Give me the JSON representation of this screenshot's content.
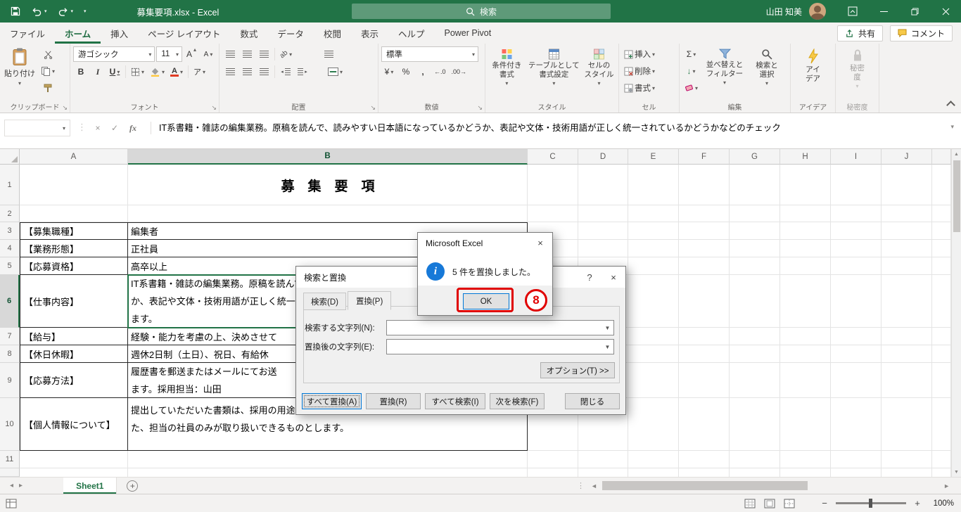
{
  "colors": {
    "excel_green": "#217346",
    "annotation_red": "#e00000",
    "info_blue": "#1779d8"
  },
  "title_bar": {
    "doc_title": "募集要項.xlsx - Excel",
    "search_label": "検索",
    "user_name": "山田 知美"
  },
  "tabs": {
    "file": "ファイル",
    "home": "ホーム",
    "insert": "挿入",
    "layout": "ページ レイアウト",
    "formulas": "数式",
    "data": "データ",
    "review": "校閲",
    "view": "表示",
    "help": "ヘルプ",
    "power_pivot": "Power Pivot",
    "share": "共有",
    "comments": "コメント"
  },
  "ribbon": {
    "paste": "貼り付け",
    "clipboard_group": "クリップボード",
    "font_name": "游ゴシック",
    "font_size": "11",
    "font_group": "フォント",
    "align_group": "配置",
    "number_format": "標準",
    "number_group": "数値",
    "conditional": "条件付き\n書式",
    "format_table": "テーブルとして\n書式設定",
    "cell_styles": "セルの\nスタイル",
    "styles_group": "スタイル",
    "insert": "挿入",
    "delete": "削除",
    "format": "書式",
    "cells_group": "セル",
    "sort_filter": "並べ替えと\nフィルター",
    "find_select": "検索と\n選択",
    "editing_group": "編集",
    "ideas": "アイ\nデア",
    "ideas_group": "アイデア",
    "sensitivity": "秘密\n度",
    "sensitivity_group": "秘密度"
  },
  "glyphs": {
    "bold": "B",
    "italic": "I",
    "underline": "U",
    "autosum": "Σ",
    "phonetic": "ア",
    "currency": "¥",
    "percent": "%",
    "comma": ",",
    "fx": "fx",
    "orientation": "ab",
    "dec_left": "←.0",
    "dec_right": ".00→",
    "fill": "↓"
  },
  "formula_bar": {
    "name_box": "",
    "value": "IT系書籍・雑誌の編集業務。原稿を読んで、読みやすい日本語になっているかどうか、表記や文体・技術用語が正しく統一されているかどうかなどのチェック"
  },
  "grid": {
    "columns": [
      "A",
      "B",
      "C",
      "D",
      "E",
      "F",
      "G",
      "H",
      "I",
      "J"
    ],
    "rows": [
      "1",
      "2",
      "3",
      "4",
      "5",
      "6",
      "7",
      "8",
      "9",
      "10",
      "11"
    ],
    "cells": {
      "b1": "募　集　要　項",
      "a3": "【募集職種】",
      "b3": "編集者",
      "a4": "【業務形態】",
      "b4": "正社員",
      "a5": "【応募資格】",
      "b5": "高卒以上",
      "a6": "【仕事内容】",
      "b6": "IT系書籍・雑誌の編集業務。原稿を読んで、読みやすい日本語になっているかどう\nか、表記や文体・技術用語が正しく統一されているかどうかなどのチェックをし\nます。",
      "a7": "【給与】",
      "b7": "経験・能力を考慮の上、決めさせて",
      "a8": "【休日休暇】",
      "b8": "週休2日制（土日）、祝日、有給休",
      "a9": "【応募方法】",
      "b9": "履歴書を郵送またはメールにてお送\nます。採用担当：山田",
      "a10": "【個人情報について】",
      "b10": "提出していただいた書類は、採用の用途でのみ使用し、厳重に管理いたします。ま\nた、担当の社員のみが取り扱いできるものとします。"
    }
  },
  "find_replace": {
    "title": "検索と置換",
    "help": "?",
    "close_x": "×",
    "tab_find": "検索(D)",
    "tab_replace": "置換(P)",
    "find_label": "検索する文字列(N):",
    "replace_label": "置換後の文字列(E):",
    "options": "オプション(T) >>",
    "replace_all": "すべて置換(A)",
    "replace": "置換(R)",
    "find_all": "すべて検索(I)",
    "find_next": "次を検索(F)",
    "close": "閉じる"
  },
  "message_box": {
    "title": "Microsoft Excel",
    "close_x": "×",
    "info_glyph": "i",
    "message": "5 件を置換しました。",
    "ok": "OK",
    "annotation_number": "8"
  },
  "sheet_bar": {
    "sheet_name": "Sheet1"
  },
  "status_bar": {
    "zoom": "100%"
  }
}
